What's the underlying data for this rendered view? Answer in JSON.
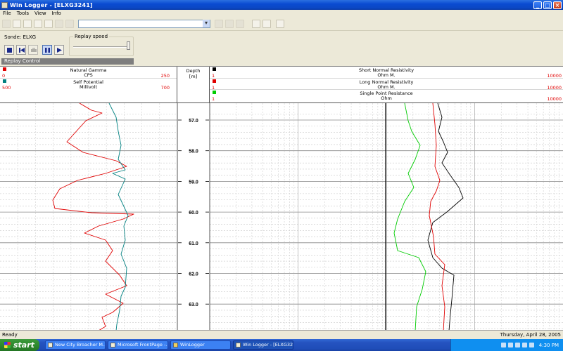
{
  "window": {
    "title": "Win Logger - [ELXG3241]"
  },
  "menu": [
    "File",
    "Tools",
    "View",
    "Info"
  ],
  "toolbar": {
    "combo_value": ""
  },
  "controls": {
    "sonde_label": "Sonde:",
    "sonde_value": "ELXG",
    "speed_label": "Replay speed",
    "replay_control_label": "Replay Control"
  },
  "tracks": {
    "left": [
      {
        "name": "Natural Gamma",
        "unit": "CPS",
        "min": "0",
        "max": "250",
        "color": "#e00000"
      },
      {
        "name": "Self Potential",
        "unit": "Millivolt",
        "min": "500",
        "max": "700",
        "color": "#008080"
      }
    ],
    "depth": {
      "label": "Depth",
      "unit": "[m]"
    },
    "right": [
      {
        "name": "Short Normal Resistivity",
        "unit": "Ohm M.",
        "min": "1",
        "max": "10000",
        "color": "#000000"
      },
      {
        "name": "Long Normal Resistivity",
        "unit": "Ohm M.",
        "min": "1",
        "max": "10000",
        "color": "#e00000"
      },
      {
        "name": "Single Point Resistance",
        "unit": "Ohm",
        "min": "1",
        "max": "10000",
        "color": "#00cc00"
      }
    ]
  },
  "depth_labels": [
    "57.0",
    "58.0",
    "59.0",
    "60.0",
    "61.0",
    "62.0",
    "63.0"
  ],
  "status": {
    "left": "Ready",
    "right": "Thursday, April 28, 2005"
  },
  "taskbar": {
    "start_label": "start",
    "tasks": [
      "New City Broacher M...",
      "Microsoft FrontPage -...",
      "WinLogger",
      "Win Logger - [ELXG32..."
    ],
    "clock": "4:30 PM"
  }
}
